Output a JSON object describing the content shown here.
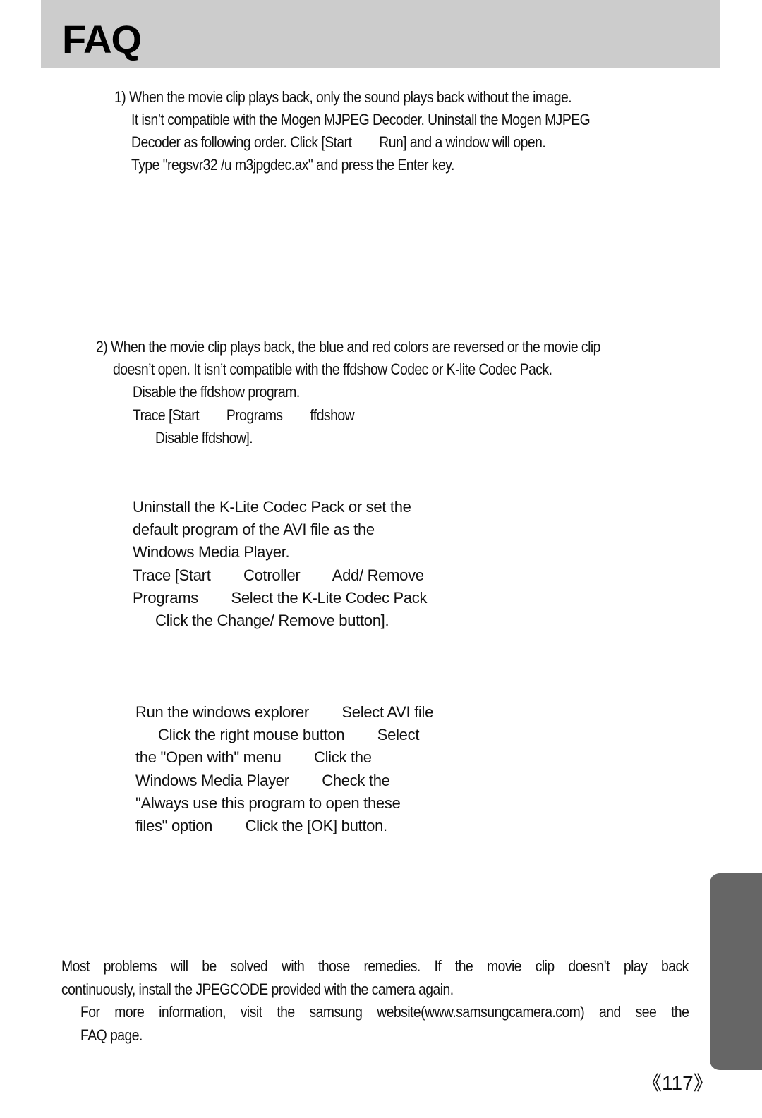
{
  "header": {
    "title": "FAQ"
  },
  "section1": {
    "lines": [
      "1) When the movie clip plays back, only the sound plays back without the image.",
      "It isn’t compatible with the Mogen MJPEG Decoder. Uninstall the Mogen MJPEG",
      "Decoder as following order. Click [Start        Run] and a window will open.",
      "Type \"regsvr32 /u m3jpgdec.ax\" and press the Enter key."
    ]
  },
  "section2": {
    "lines": [
      "2) When the movie clip plays back, the blue and red colors are reversed or the movie clip",
      "doesn’t open. It isn’t compatible with the ffdshow Codec or K-lite Codec Pack.",
      "Disable the ffdshow program.",
      "Trace [Start        Programs        ffdshow",
      "Disable ffdshow]."
    ],
    "klite": [
      "Uninstall the K-Lite Codec Pack or set the",
      "default program of the AVI file as the",
      "Windows Media Player.",
      "Trace [Start        Cotroller        Add/ Remove",
      "Programs        Select the K-Lite Codec Pack",
      "Click the Change/ Remove button]."
    ],
    "explorer": [
      "Run the windows explorer        Select AVI file",
      "Click the right mouse button        Select",
      "the \"Open with\" menu        Click the",
      "Windows Media Player        Check the",
      "\"Always use this program to open these",
      "files\" option        Click the [OK] button."
    ]
  },
  "footer_notes": {
    "p1_line1": "Most problems will be solved with those remedies. If the movie clip doesn’t play back",
    "p1_line2": "continuously, install the JPEGCODE provided with the camera again.",
    "p2_line1": "For more information, visit the samsung website(www.samsungcamera.com) and see the",
    "p2_line2": "FAQ page."
  },
  "page_number": "《117》"
}
